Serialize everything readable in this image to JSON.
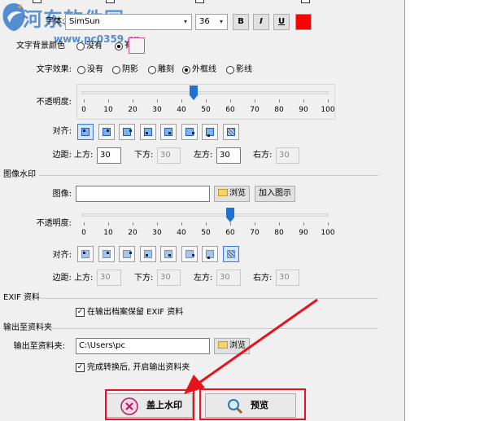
{
  "watermark_logo": {
    "title": "河东软件园",
    "url": "www.pc0359.cn"
  },
  "text_settings": {
    "font_label": "字体:",
    "font_value": "SimSun",
    "size_value": "36",
    "bold": "B",
    "italic": "I",
    "underline": "U",
    "color": "#ff0000",
    "bg_label": "文字背景颜色",
    "bg_options": [
      "没有",
      "有"
    ],
    "effect_label": "文字效果:",
    "effects": [
      "没有",
      "阴影",
      "雕刻",
      "外框线",
      "影线"
    ],
    "effect_selected": 3,
    "opacity_label": "不透明度:",
    "opacity_value": 45,
    "ticks": [
      "0",
      "10",
      "20",
      "30",
      "40",
      "50",
      "60",
      "70",
      "80",
      "90",
      "100"
    ],
    "align_label": "对齐:",
    "margin_label": "边距:",
    "top_label": "上方:",
    "top_value": "30",
    "bottom_label": "下方:",
    "bottom_value": "30",
    "left_label": "左方:",
    "left_value": "30",
    "right_label": "右方:",
    "right_value": "30"
  },
  "image_watermark": {
    "section_title": "图像水印",
    "image_label": "图像:",
    "image_value": "",
    "browse_label": "浏览",
    "add_label": "加入图示",
    "opacity_label": "不透明度:",
    "opacity_value": 60,
    "ticks": [
      "0",
      "10",
      "20",
      "30",
      "40",
      "50",
      "60",
      "70",
      "80",
      "90",
      "100"
    ],
    "align_label": "对齐:",
    "margin_label": "边距:",
    "top_label": "上方:",
    "top_value": "30",
    "bottom_label": "下方:",
    "bottom_value": "30",
    "left_label": "左方:",
    "left_value": "30",
    "right_label": "右方:",
    "right_value": "30"
  },
  "exif": {
    "section_title": "EXIF 资料",
    "keep_label": "在输出档案保留 EXIF 资料",
    "keep_checked": true
  },
  "output": {
    "section_title": "输出至资料夹",
    "folder_label": "输出至资料夹:",
    "folder_value": "C:\\Users\\pc",
    "browse_label": "浏览",
    "open_label": "完成转换后, 开启输出资料夹",
    "open_checked": true
  },
  "actions": {
    "apply_label": "盖上水印",
    "preview_label": "预览"
  },
  "colors": {
    "highlight": "#e8121d",
    "slider": "#1e73d2"
  }
}
